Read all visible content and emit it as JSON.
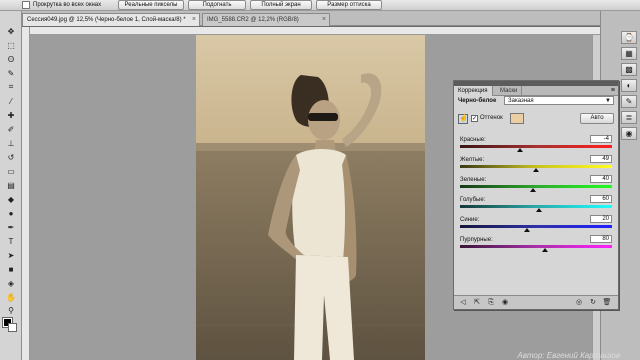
{
  "options_bar": {
    "checkbox_label": "Прокрутка во всех окнах",
    "buttons": [
      "Реальные пикселы",
      "Подогнать",
      "Полный экран",
      "Размер оттиска"
    ]
  },
  "documents": {
    "tabs": [
      {
        "label": "Сессия049.jpg @ 12,5% (Черно-белое 1, Слой-маска/8) *",
        "close": "×"
      },
      {
        "label": "IMG_5588.CR2 @ 12,2% (RGB/8)",
        "close": "×"
      }
    ]
  },
  "panel": {
    "tabs": [
      "Коррекция",
      "Маски"
    ],
    "menu": "≡",
    "adjustment": "Черно-белое",
    "preset": "Заказная",
    "tint_label": "Оттенок",
    "tint_checked": "✓",
    "tint_color": "#ebcfa4",
    "auto_label": "Авто",
    "sliders": [
      {
        "label": "Красные:",
        "value": "-4",
        "level": -4,
        "gradient": "linear-gradient(90deg,#3a1515,#a83030,#ff2020)"
      },
      {
        "label": "Желтые:",
        "value": "49",
        "level": 49,
        "gradient": "linear-gradient(90deg,#3a3815,#c8c020,#ffff20)"
      },
      {
        "label": "Зеленые:",
        "value": "40",
        "level": 40,
        "gradient": "linear-gradient(90deg,#153a15,#2ea82e,#20ff20)"
      },
      {
        "label": "Голубые:",
        "value": "60",
        "level": 60,
        "gradient": "linear-gradient(90deg,#153838,#2aa8a8,#20ffff)"
      },
      {
        "label": "Синие:",
        "value": "20",
        "level": 20,
        "gradient": "linear-gradient(90deg,#15153a,#3030a8,#2020ff)"
      },
      {
        "label": "Пурпурные:",
        "value": "80",
        "level": 80,
        "gradient": "linear-gradient(90deg,#3a153a,#a830a8,#ff20ff)"
      }
    ]
  },
  "watermark": "Автор: Евгений Карташов"
}
